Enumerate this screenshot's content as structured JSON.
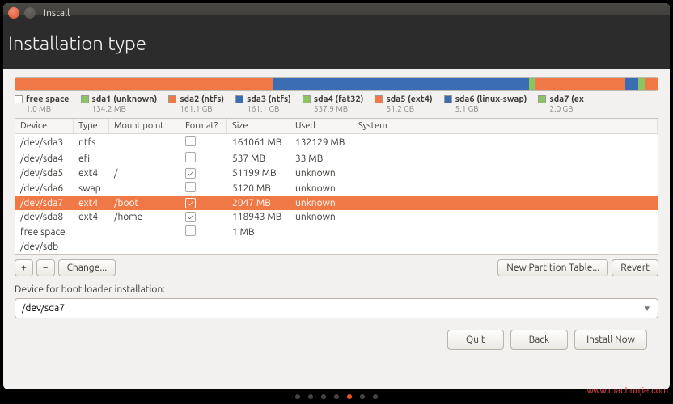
{
  "window": {
    "title": "Install"
  },
  "heading": "Installation type",
  "diskbar_segments": [
    {
      "color": "#f07746",
      "flex": 40
    },
    {
      "color": "#3b6db5",
      "flex": 40
    },
    {
      "color": "#8ac561",
      "flex": 1
    },
    {
      "color": "#f07746",
      "flex": 14
    },
    {
      "color": "#3b6db5",
      "flex": 2
    },
    {
      "color": "#8ac561",
      "flex": 1
    },
    {
      "color": "#f07746",
      "flex": 2
    }
  ],
  "legend": [
    {
      "swatch": "#ffffff",
      "border": "#999",
      "label": "free space",
      "sub": "1.0 MB"
    },
    {
      "swatch": "#8ac561",
      "label": "sda1 (unknown)",
      "sub": "134.2 MB"
    },
    {
      "swatch": "#f07746",
      "label": "sda2 (ntfs)",
      "sub": "161.1 GB"
    },
    {
      "swatch": "#3b6db5",
      "label": "sda3 (ntfs)",
      "sub": "161.1 GB"
    },
    {
      "swatch": "#8ac561",
      "label": "sda4 (fat32)",
      "sub": "537.9 MB"
    },
    {
      "swatch": "#f07746",
      "label": "sda5 (ext4)",
      "sub": "51.2 GB"
    },
    {
      "swatch": "#3b6db5",
      "label": "sda6 (linux-swap)",
      "sub": "5.1 GB"
    },
    {
      "swatch": "#8ac561",
      "label": "sda7 (ex",
      "sub": "2.0 GB"
    }
  ],
  "columns": {
    "device": "Device",
    "type": "Type",
    "mount": "Mount point",
    "format": "Format?",
    "size": "Size",
    "used": "Used",
    "system": "System"
  },
  "rows": [
    {
      "device": "/dev/sda3",
      "type": "ntfs",
      "mount": "",
      "format": false,
      "size": "161061 MB",
      "used": "132129 MB",
      "system": ""
    },
    {
      "device": "/dev/sda4",
      "type": "efi",
      "mount": "",
      "format": false,
      "size": "537 MB",
      "used": "33 MB",
      "system": ""
    },
    {
      "device": "/dev/sda5",
      "type": "ext4",
      "mount": "/",
      "format": true,
      "size": "51199 MB",
      "used": "unknown",
      "system": ""
    },
    {
      "device": "/dev/sda6",
      "type": "swap",
      "mount": "",
      "format": false,
      "size": "5120 MB",
      "used": "unknown",
      "system": ""
    },
    {
      "device": "/dev/sda7",
      "type": "ext4",
      "mount": "/boot",
      "format": true,
      "size": "2047 MB",
      "used": "unknown",
      "system": "",
      "selected": true
    },
    {
      "device": "/dev/sda8",
      "type": "ext4",
      "mount": "/home",
      "format": true,
      "size": "118943 MB",
      "used": "unknown",
      "system": ""
    },
    {
      "device": "free space",
      "type": "",
      "mount": "",
      "format": false,
      "size": "1 MB",
      "used": "",
      "system": ""
    },
    {
      "device": "/dev/sdb",
      "type": "",
      "mount": "",
      "format": null,
      "size": "",
      "used": "",
      "system": ""
    }
  ],
  "toolbar": {
    "add": "+",
    "remove": "−",
    "change": "Change...",
    "newtable": "New Partition Table...",
    "revert": "Revert"
  },
  "bootloader": {
    "label": "Device for boot loader installation:",
    "value": "/dev/sda7"
  },
  "footer": {
    "quit": "Quit",
    "back": "Back",
    "install": "Install Now"
  },
  "watermark": "www.machunjie.com",
  "dots": {
    "total": 7,
    "active": 4
  }
}
